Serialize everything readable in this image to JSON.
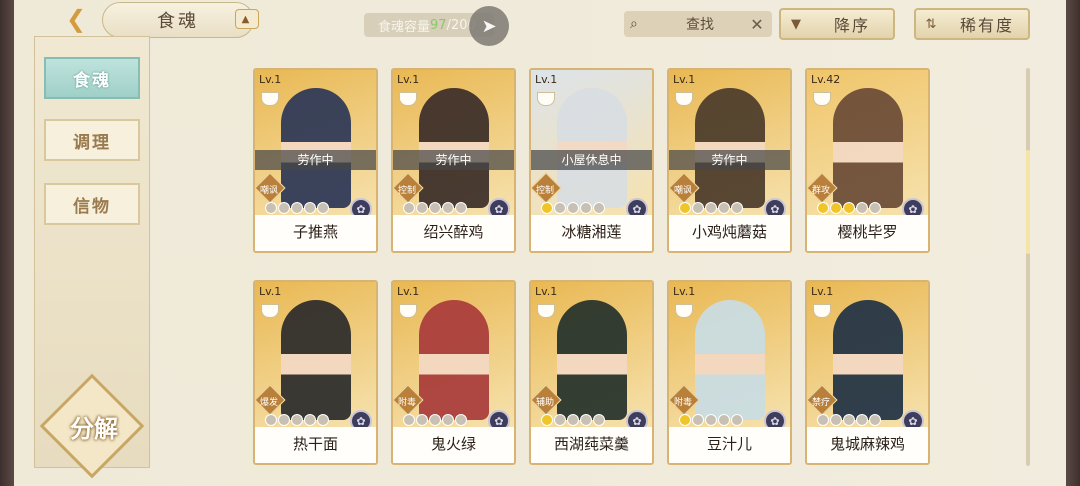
{
  "header": {
    "back_icon": "chevron-left-icon",
    "title": "食魂",
    "capacity_label": "食魂容量 ",
    "capacity_current": "97",
    "capacity_total": "/200",
    "share_icon": "paper-plane-icon",
    "search_label": "查找",
    "search_clear": "✕",
    "sort_desc_label": "降序",
    "sort_rarity_label": "稀有度"
  },
  "sidebar": {
    "tabs": [
      {
        "label": "食魂",
        "active": true
      },
      {
        "label": "调理",
        "active": false
      },
      {
        "label": "信物",
        "active": false
      }
    ],
    "decompose_label": "分解"
  },
  "cards": [
    {
      "level": "Lv.1",
      "status": "劳作中",
      "role": "嘲讽",
      "stars": 0,
      "name": "子推燕",
      "bg": "#e9b853",
      "hair": "#2b3656"
    },
    {
      "level": "Lv.1",
      "status": "劳作中",
      "role": "控制",
      "stars": 0,
      "name": "绍兴醉鸡",
      "bg": "#e9b853",
      "hair": "#3a2c28"
    },
    {
      "level": "Lv.1",
      "status": "小屋休息中",
      "role": "控制",
      "stars": 1,
      "name": "冰糖湘莲",
      "bg": "#dde3ea",
      "hair": "#d8dde2"
    },
    {
      "level": "Lv.1",
      "status": "劳作中",
      "role": "嘲讽",
      "stars": 1,
      "name": "小鸡炖蘑菇",
      "bg": "#e9b853",
      "hair": "#4a3a2a"
    },
    {
      "level": "Lv.42",
      "status": "",
      "role": "群攻",
      "stars": 3,
      "name": "樱桃毕罗",
      "bg": "#f0c56a",
      "hair": "#6a4a36"
    },
    {
      "level": "Lv.1",
      "status": "",
      "role": "爆发",
      "stars": 0,
      "name": "热干面",
      "bg": "#e9b853",
      "hair": "#2a2a2a"
    },
    {
      "level": "Lv.1",
      "status": "",
      "role": "附毒",
      "stars": 0,
      "name": "鬼火绿",
      "bg": "#e9b853",
      "hair": "#a83a3a"
    },
    {
      "level": "Lv.1",
      "status": "",
      "role": "辅助",
      "stars": 1,
      "name": "西湖莼菜羹",
      "bg": "#e9b853",
      "hair": "#23302a"
    },
    {
      "level": "Lv.1",
      "status": "",
      "role": "附毒",
      "stars": 1,
      "name": "豆汁儿",
      "bg": "#e9b853",
      "hair": "#c9dde4"
    },
    {
      "level": "Lv.1",
      "status": "",
      "role": "禁疗",
      "stars": 0,
      "name": "鬼城麻辣鸡",
      "bg": "#e9b853",
      "hair": "#1f3144"
    }
  ],
  "scroll_fraction": 0.25
}
